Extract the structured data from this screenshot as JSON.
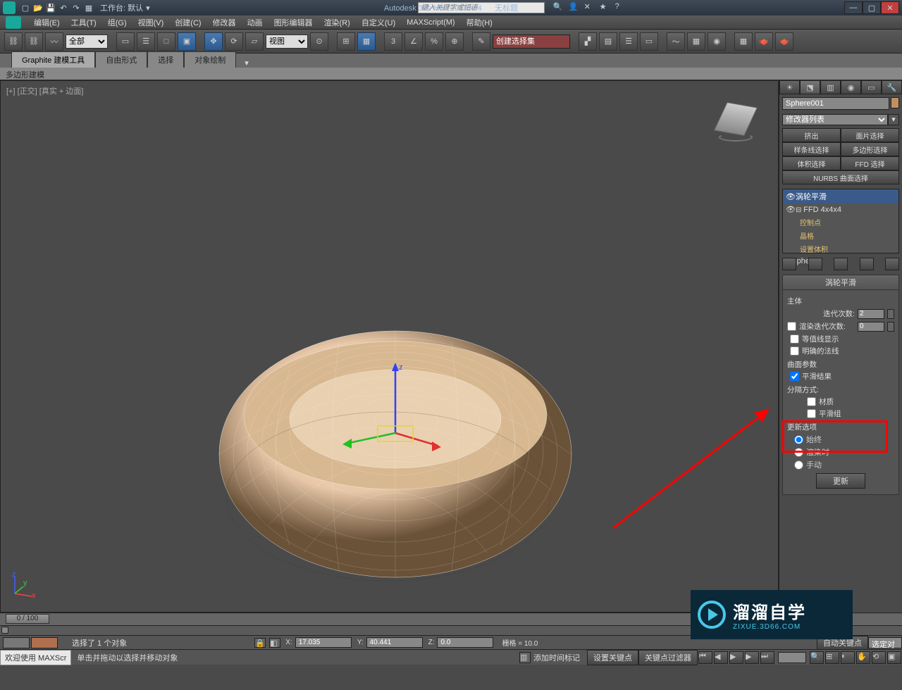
{
  "titlebar": {
    "workspace_label": "工作台: 默认",
    "app_title": "Autodesk 3ds Max  2013 x64",
    "doc_title": "无标题",
    "search_placeholder": "键入关键字或短语"
  },
  "menubar": {
    "items": [
      "编辑(E)",
      "工具(T)",
      "组(G)",
      "视图(V)",
      "创建(C)",
      "修改器",
      "动画",
      "图形编辑器",
      "渲染(R)",
      "自定义(U)",
      "MAXScript(M)",
      "帮助(H)"
    ]
  },
  "toolbar": {
    "filter_all": "全部",
    "view_dropdown": "视图",
    "named_selection": "创建选择集"
  },
  "ribbon": {
    "tabs": [
      "Graphite 建模工具",
      "自由形式",
      "选择",
      "对象绘制"
    ],
    "active": 0,
    "poly_label": "多边形建模"
  },
  "viewport": {
    "label": "[+] [正交] [真实 + 边面]"
  },
  "cmd_panel": {
    "obj_name": "Sphere001",
    "modifier_list": "修改器列表",
    "mod_buttons": [
      "挤出",
      "面片选择",
      "样条线选择",
      "多边形选择",
      "体积选择",
      "FFD 选择",
      "NURBS 曲面选择"
    ],
    "stack": {
      "items": [
        {
          "label": "涡轮平滑",
          "selected": true
        },
        {
          "label": "FFD 4x4x4"
        },
        {
          "label": "控制点",
          "sub": true
        },
        {
          "label": "晶格",
          "sub": true
        },
        {
          "label": "设置体积",
          "sub": true
        },
        {
          "label": "Sphere"
        }
      ]
    },
    "rollout": {
      "title": "涡轮平滑",
      "main_group": "主体",
      "iterations_label": "迭代次数:",
      "iterations_value": "2",
      "render_iters_label": "渲染迭代次数:",
      "render_iters_value": "0",
      "isoline_label": "等值线显示",
      "explicit_normals_label": "明确的法线",
      "surface_params": "曲面参数",
      "smooth_result_label": "平滑结果",
      "separate_by": "分隔方式:",
      "material_label": "材质",
      "smoothgroup_label": "平滑组",
      "update_options": "更新选项",
      "always": "始终",
      "render": "渲染时",
      "manual": "手动",
      "update_btn": "更新"
    }
  },
  "timeline": {
    "scrub": "0 / 100"
  },
  "status": {
    "selection": "选择了 1 个对象",
    "x_label": "X:",
    "x_val": "17.035",
    "y_label": "Y:",
    "y_val": "40.441",
    "z_label": "Z:",
    "z_val": "0.0",
    "grid": "栅格 = 10.0",
    "autokey": "自动关键点",
    "selkey": "选定对",
    "welcome": "欢迎使用 MAXScr",
    "prompt": "单击并拖动以选择并移动对象",
    "addtime": "添加时间标记",
    "setkey": "设置关键点",
    "keyfilter": "关键点过滤器"
  },
  "watermark": {
    "brand": "溜溜自学",
    "url": "ZIXUE.3D66.COM"
  }
}
